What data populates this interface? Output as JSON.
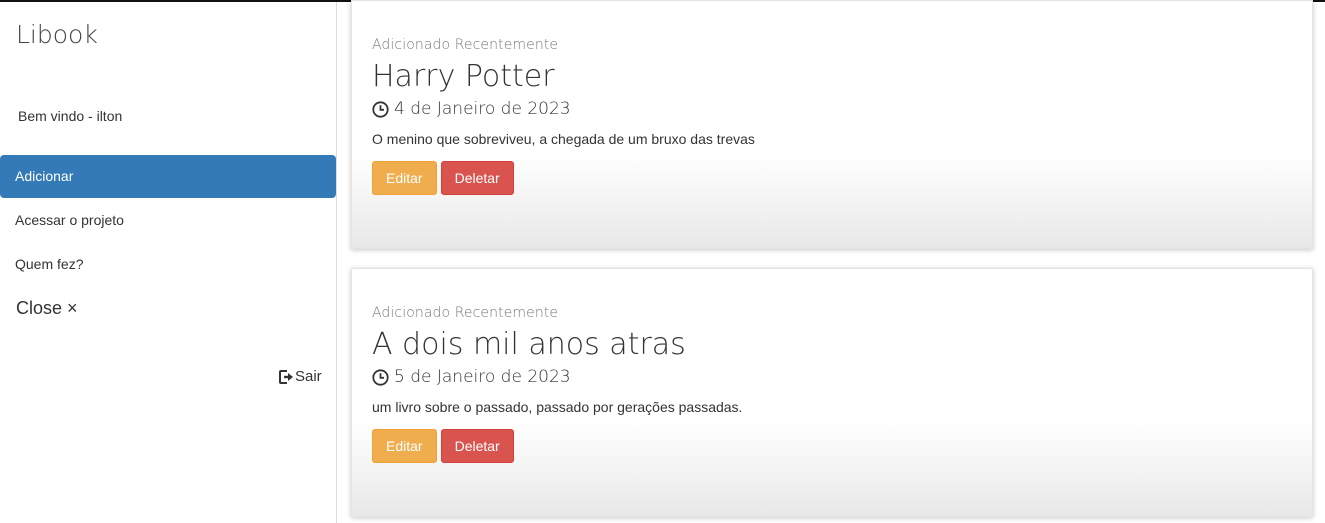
{
  "sidebar": {
    "brand": "Libook",
    "welcome": "Bem vindo - ilton",
    "items": [
      {
        "label": "Adicionar"
      },
      {
        "label": "Acessar o projeto"
      },
      {
        "label": "Quem fez?"
      }
    ],
    "close_label": "Close ×",
    "logout_label": "Sair",
    "active_color": "#337ab7"
  },
  "books": [
    {
      "eyebrow": "Adicionado Recentemente",
      "title": "Harry Potter",
      "date": "4 de Janeiro de 2023",
      "description": "O menino que sobreviveu, a chegada de um bruxo das trevas",
      "edit_label": "Editar",
      "delete_label": "Deletar"
    },
    {
      "eyebrow": "Adicionado Recentemente",
      "title": "A dois mil anos atras",
      "date": "5 de Janeiro de 2023",
      "description": "um livro sobre o passado, passado por gerações passadas.",
      "edit_label": "Editar",
      "delete_label": "Deletar"
    }
  ],
  "colors": {
    "edit_button": "#f0ad4e",
    "delete_button": "#d9534f"
  },
  "icons": {
    "date": "clock-icon",
    "logout": "logout-icon"
  }
}
